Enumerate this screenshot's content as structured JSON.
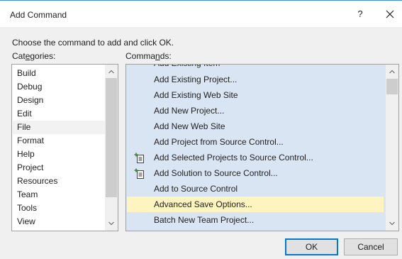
{
  "window": {
    "title": "Add Command",
    "help_label": "?"
  },
  "instruction": "Choose the command to add and click OK.",
  "categories": {
    "label_pre": "Cat",
    "label_accel": "e",
    "label_post": "gories:",
    "items": [
      "Build",
      "Debug",
      "Design",
      "Edit",
      "File",
      "Format",
      "Help",
      "Project",
      "Resources",
      "Team",
      "Tools",
      "View"
    ],
    "selected": "File"
  },
  "commands": {
    "label_pre": "Comma",
    "label_accel": "n",
    "label_post": "ds:",
    "partial_item": "Add Existing Item",
    "items": [
      {
        "label": "Add Existing Project...",
        "icon": ""
      },
      {
        "label": "Add Existing Web Site",
        "icon": ""
      },
      {
        "label": "Add New Project...",
        "icon": ""
      },
      {
        "label": "Add New Web Site",
        "icon": ""
      },
      {
        "label": "Add Project from Source Control...",
        "icon": ""
      },
      {
        "label": "Add Selected Projects to Source Control...",
        "icon": "add-to-source-control-icon"
      },
      {
        "label": "Add Solution to Source Control...",
        "icon": "add-to-source-control-icon"
      },
      {
        "label": "Add to Source Control",
        "icon": ""
      },
      {
        "label": "Advanced Save Options...",
        "icon": ""
      },
      {
        "label": "Batch New Team Project...",
        "icon": ""
      }
    ],
    "highlighted": "Advanced Save Options..."
  },
  "buttons": {
    "ok": "OK",
    "cancel": "Cancel"
  },
  "colors": {
    "commands_background": "#dae5f3",
    "highlight": "#fdf4bf",
    "title_accent": "#3b8ee0"
  }
}
